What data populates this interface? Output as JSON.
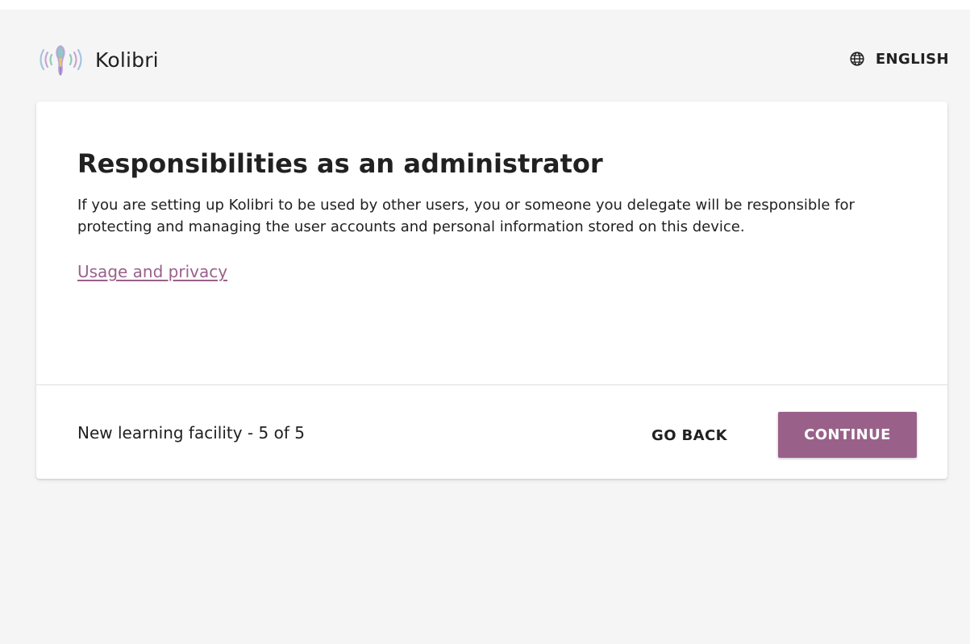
{
  "header": {
    "app_name": "Kolibri",
    "language_label": "ENGLISH",
    "language_icon": "globe-icon",
    "logo_icon": "kolibri-logo"
  },
  "card": {
    "title": "Responsibilities as an administrator",
    "description": "If you are setting up Kolibri to be used by other users, you or someone you delegate will be responsible for protecting and managing the user accounts and personal information stored on this device.",
    "link_label": "Usage and privacy"
  },
  "footer": {
    "step_text": "New learning facility - 5 of 5",
    "back_label": "GO BACK",
    "continue_label": "CONTINUE"
  },
  "colors": {
    "accent": "#996189",
    "page_background": "#f5f5f5",
    "card_background": "#ffffff",
    "text": "#212121"
  }
}
